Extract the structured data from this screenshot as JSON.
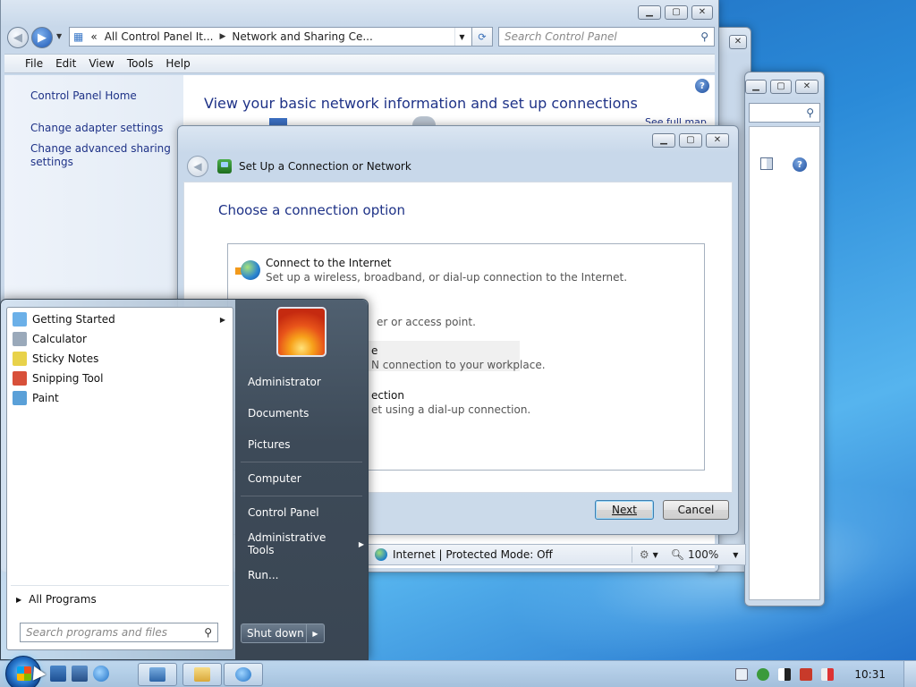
{
  "control_panel": {
    "address_prefix": "«",
    "address_segments": [
      "All Control Panel It...",
      "Network and Sharing Ce..."
    ],
    "search_placeholder": "Search Control Panel",
    "menu": [
      "File",
      "Edit",
      "View",
      "Tools",
      "Help"
    ],
    "sidebar_links": [
      "Control Panel Home",
      "Change adapter settings",
      "Change advanced sharing settings"
    ],
    "heading": "View your basic network information and set up connections",
    "see_full_map": "See full map"
  },
  "dialog": {
    "title": "Set Up a Connection or Network",
    "heading": "Choose a connection option",
    "options": [
      {
        "title": "Connect to the Internet",
        "desc": "Set up a wireless, broadband, or dial-up connection to the Internet."
      },
      {
        "title": "",
        "desc": "er or access point."
      },
      {
        "title": "e",
        "desc": "N connection to your workplace."
      },
      {
        "title": "ection",
        "desc": "et using a dial-up connection."
      }
    ],
    "next_label": "Next",
    "cancel_label": "Cancel"
  },
  "status_bar": {
    "zone_text": "Internet | Protected Mode: Off",
    "zoom": "100%"
  },
  "start_menu": {
    "programs": [
      {
        "label": "Getting Started",
        "has_arrow": true,
        "icon_color": "#6bb0e8"
      },
      {
        "label": "Calculator",
        "has_arrow": false,
        "icon_color": "#9aa9ba"
      },
      {
        "label": "Sticky Notes",
        "has_arrow": false,
        "icon_color": "#e8d24a"
      },
      {
        "label": "Snipping Tool",
        "has_arrow": false,
        "icon_color": "#d8503a"
      },
      {
        "label": "Paint",
        "has_arrow": false,
        "icon_color": "#5aa0d8"
      }
    ],
    "all_programs": "All Programs",
    "search_placeholder": "Search programs and files",
    "right_links": [
      "Administrator",
      "Documents",
      "Pictures",
      "Computer",
      "Control Panel",
      "Administrative Tools",
      "Run..."
    ],
    "shutdown_label": "Shut down"
  },
  "taskbar": {
    "clock": "10:31"
  }
}
